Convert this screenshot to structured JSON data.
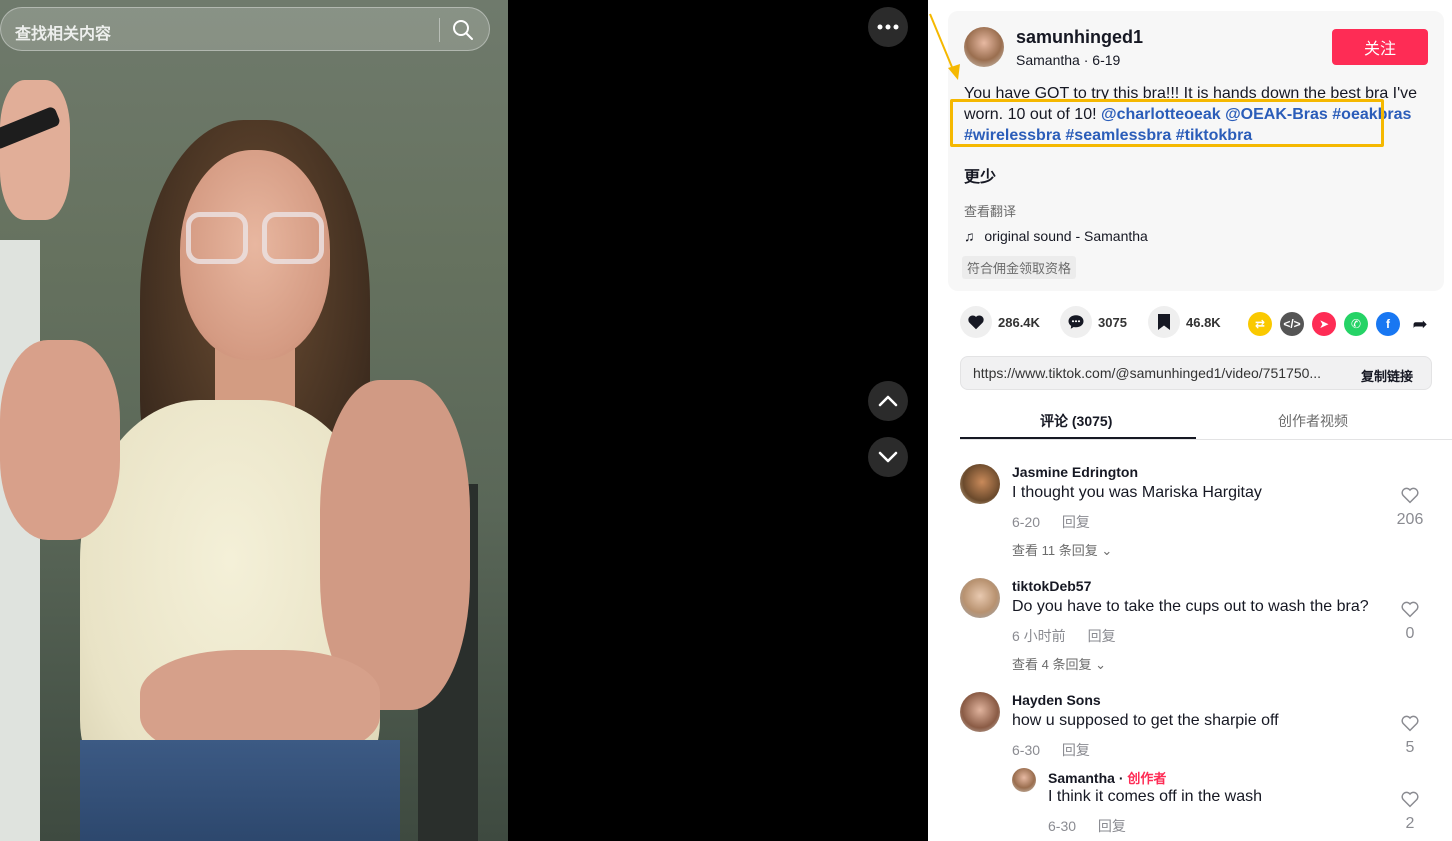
{
  "search": {
    "placeholder": "查找相关内容"
  },
  "post": {
    "username": "samunhinged1",
    "display_name": "Samantha",
    "date": "6-19",
    "follow_label": "关注",
    "desc_text": "You have GOT to try this bra!!! It is hands down the best bra I've worn. 10 out of 10!",
    "mentions": [
      "@charlotteoeak",
      "@OEAK-Bras"
    ],
    "hashtags": [
      "#oeakbras",
      "#wirelessbra",
      "#seamlessbra",
      "#tiktokbra"
    ],
    "less_label": "更少",
    "translate_label": "查看翻译",
    "sound": "original sound - Samantha",
    "commission_label": "符合佣金领取资格"
  },
  "stats": {
    "likes": "286.4K",
    "comments": "3075",
    "saves": "46.8K"
  },
  "share": {
    "link": "https://www.tiktok.com/@samunhinged1/video/751750...",
    "copy_label": "复制链接"
  },
  "tabs": {
    "comments_label": "评论 (3075)",
    "creator_label": "创作者视频"
  },
  "comments": [
    {
      "name": "Jasmine Edrington",
      "text": "I thought you was Mariska Hargitay",
      "date": "6-20",
      "reply_label": "回复",
      "likes": "206",
      "more_replies": "查看 11 条回复"
    },
    {
      "name": "tiktokDeb57",
      "text": "Do you have to take the cups out to wash the bra?",
      "date": "6 小时前",
      "reply_label": "回复",
      "likes": "0",
      "more_replies": "查看 4 条回复"
    },
    {
      "name": "Hayden Sons",
      "text": "how u supposed to get the sharpie off",
      "date": "6-30",
      "reply_label": "回复",
      "likes": "5"
    }
  ],
  "creator_reply": {
    "name": "Samantha",
    "creator_label": "创作者",
    "text": "I think it comes off in the wash",
    "date": "6-30",
    "reply_label": "回复",
    "likes": "2"
  },
  "colors": {
    "accent": "#fe2c55",
    "link": "#2b5db9",
    "highlight": "#f5b800"
  }
}
